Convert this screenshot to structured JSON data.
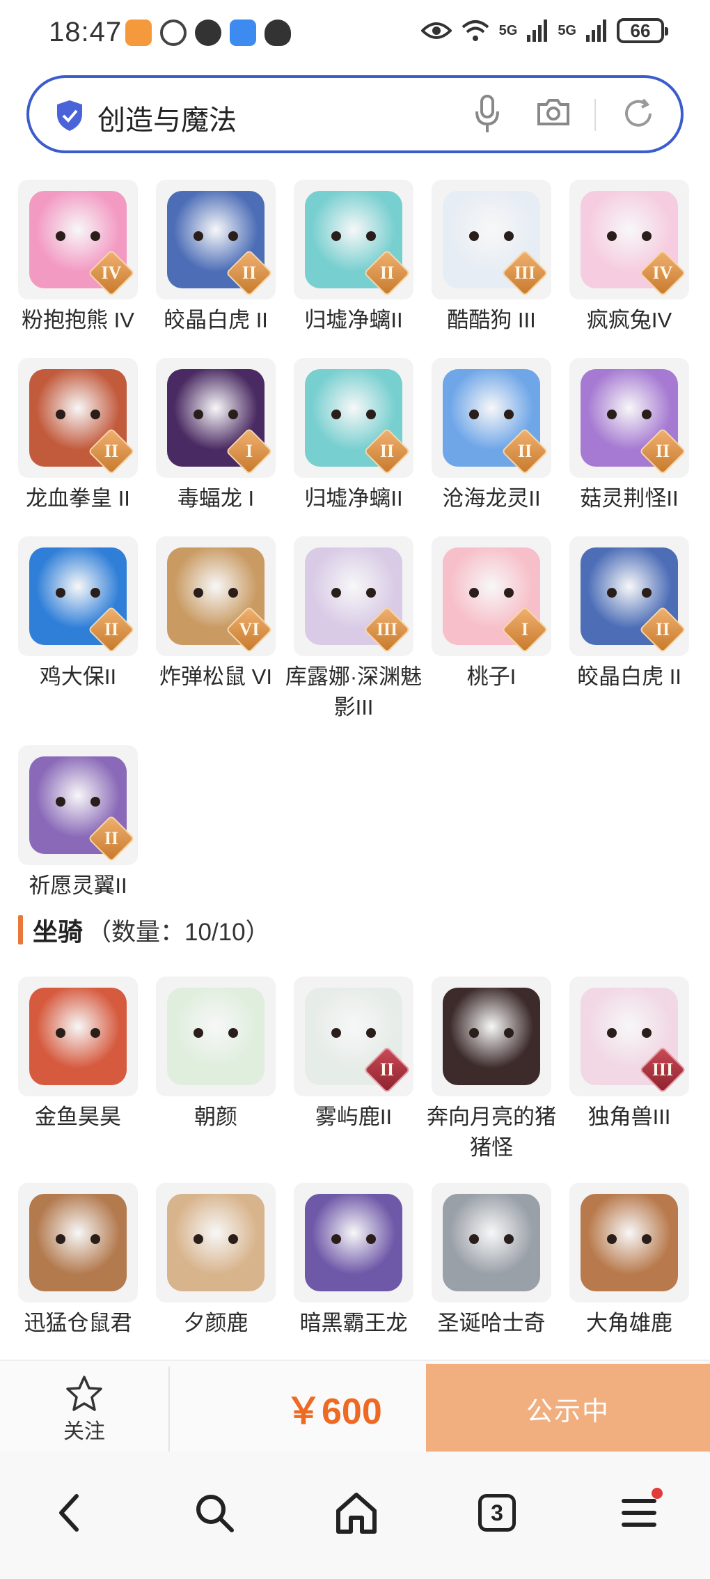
{
  "status": {
    "time": "18:47",
    "signal1": "5G",
    "signal2": "5G",
    "battery": "66"
  },
  "search": {
    "query": "创造与魔法"
  },
  "items": [
    {
      "name": "粉抱抱熊 IV",
      "rank": "IV",
      "color": "#f39ac3"
    },
    {
      "name": "皎晶白虎 II",
      "rank": "II",
      "color": "#4d6eb7"
    },
    {
      "name": "归墟净螭II",
      "rank": "II",
      "color": "#78cfd0"
    },
    {
      "name": "酷酷狗 III",
      "rank": "III",
      "color": "#e7edf4"
    },
    {
      "name": "疯疯兔IV",
      "rank": "IV",
      "color": "#f6cde0"
    },
    {
      "name": "龙血拳皇 II",
      "rank": "II",
      "color": "#c25a3c"
    },
    {
      "name": "毒蝠龙 I",
      "rank": "I",
      "color": "#4a2a62"
    },
    {
      "name": "归墟净螭II",
      "rank": "II",
      "color": "#78cfd0"
    },
    {
      "name": "沧海龙灵II",
      "rank": "II",
      "color": "#6fa6e8"
    },
    {
      "name": "菇灵荆怪II",
      "rank": "II",
      "color": "#a67ad2"
    },
    {
      "name": "鸡大保II",
      "rank": "II",
      "color": "#2f7fd8"
    },
    {
      "name": "炸弹松鼠 VI",
      "rank": "VI",
      "color": "#c99a62"
    },
    {
      "name": "库露娜·深渊魅影III",
      "rank": "III",
      "color": "#d9cbe6"
    },
    {
      "name": "桃子I",
      "rank": "I",
      "color": "#f7bfc9"
    },
    {
      "name": "皎晶白虎 II",
      "rank": "II",
      "color": "#4d6eb7"
    },
    {
      "name": "祈愿灵翼II",
      "rank": "II",
      "color": "#8a6ab8"
    }
  ],
  "mounts_section": {
    "title": "坐骑",
    "count": "（数量：10/10）"
  },
  "mounts": [
    {
      "name": "金鱼昊昊",
      "rank": "",
      "color": "#d65a3e"
    },
    {
      "name": "朝颜",
      "rank": "",
      "color": "#dfeedd"
    },
    {
      "name": "雾屿鹿II",
      "rank": "II",
      "color": "#e6ece8"
    },
    {
      "name": "奔向月亮的猪猪怪",
      "rank": "",
      "color": "#3d2b2b"
    },
    {
      "name": "独角兽III",
      "rank": "III",
      "color": "#f1d8e4"
    },
    {
      "name": "迅猛仓鼠君",
      "rank": "",
      "color": "#b37a4e"
    },
    {
      "name": "夕颜鹿",
      "rank": "",
      "color": "#d8b48c"
    },
    {
      "name": "暗黑霸王龙",
      "rank": "",
      "color": "#6e58a8"
    },
    {
      "name": "圣诞哈士奇",
      "rank": "",
      "color": "#9aa0a8"
    },
    {
      "name": "大角雄鹿",
      "rank": "",
      "color": "#b87a4c"
    }
  ],
  "action_bar": {
    "follow": "关注",
    "price": "￥600",
    "status": "公示中"
  },
  "nav": {
    "tabs": "3"
  }
}
